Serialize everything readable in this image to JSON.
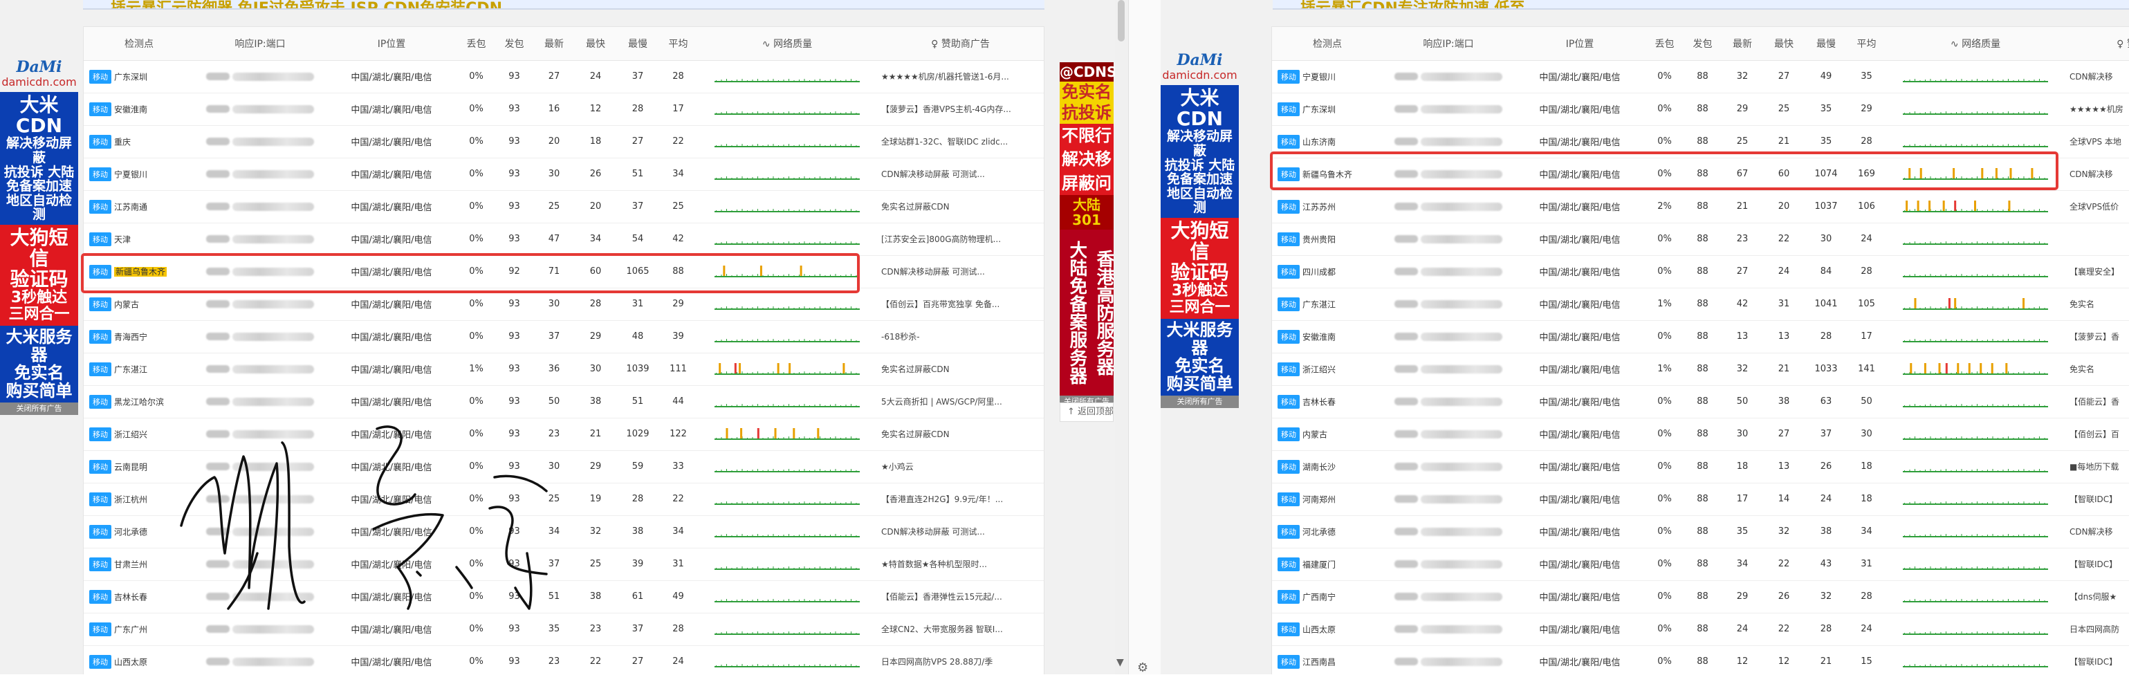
{
  "banner_left": "插云暴汇云防御器 免IE过免受攻击 ISP CDN免安装CDN",
  "banner_right": "插云暴汇CDN专注攻防加速 低至",
  "headers": [
    "检测点",
    "响应IP:端口",
    "IP位置",
    "丢包",
    "发包",
    "最新",
    "最快",
    "最慢",
    "平均",
    "网络质量",
    "赞助商广告"
  ],
  "mobile_badge": "移动",
  "left_rows": [
    {
      "loc": "广东深圳",
      "ip": "中国/湖北/襄阳/电信",
      "loss": "0%",
      "sent": "93",
      "latest": "27",
      "fast": "24",
      "slow": "37",
      "avg": "28",
      "spikes": [],
      "ad": "★★★★★机房/机器托管送1-6月..."
    },
    {
      "loc": "安徽淮南",
      "ip": "中国/湖北/襄阳/电信",
      "loss": "0%",
      "sent": "93",
      "latest": "16",
      "fast": "12",
      "slow": "28",
      "avg": "17",
      "spikes": [],
      "ad": "【菠萝云】香港VPS主机-4G内存..."
    },
    {
      "loc": "重庆",
      "ip": "中国/湖北/襄阳/电信",
      "loss": "0%",
      "sent": "93",
      "latest": "20",
      "fast": "18",
      "slow": "27",
      "avg": "22",
      "spikes": [],
      "ad": "全球站群1-32C、智联IDC zlidc..."
    },
    {
      "loc": "宁夏银川",
      "ip": "中国/湖北/襄阳/电信",
      "loss": "0%",
      "sent": "93",
      "latest": "30",
      "fast": "26",
      "slow": "51",
      "avg": "34",
      "spikes": [],
      "ad": "CDN解决移动屏蔽 可测试..."
    },
    {
      "loc": "江苏南通",
      "ip": "中国/湖北/襄阳/电信",
      "loss": "0%",
      "sent": "93",
      "latest": "25",
      "fast": "20",
      "slow": "37",
      "avg": "25",
      "spikes": [],
      "ad": "免实名过屏蔽CDN"
    },
    {
      "loc": "天津",
      "ip": "中国/湖北/襄阳/电信",
      "loss": "0%",
      "sent": "93",
      "latest": "47",
      "fast": "34",
      "slow": "54",
      "avg": "42",
      "spikes": [],
      "ad": "[江苏安全云]800G高防物理机..."
    },
    {
      "loc": "新疆乌鲁木齐",
      "ip": "中国/湖北/襄阳/电信",
      "loss": "0%",
      "sent": "92",
      "latest": "71",
      "fast": "60",
      "slow": "1065",
      "avg": "88",
      "spikes": [
        {
          "x": 0.06,
          "c": "#e8a000"
        },
        {
          "x": 0.32,
          "c": "#e8a000"
        },
        {
          "x": 0.6,
          "c": "#e8a000"
        }
      ],
      "ad": "CDN解决移动屏蔽 可测试..."
    },
    {
      "loc": "内蒙古",
      "ip": "中国/湖北/襄阳/电信",
      "loss": "0%",
      "sent": "93",
      "latest": "30",
      "fast": "28",
      "slow": "31",
      "avg": "29",
      "spikes": [],
      "ad": "【佰创云】百兆带宽独享 免备..."
    },
    {
      "loc": "青海西宁",
      "ip": "中国/湖北/襄阳/电信",
      "loss": "0%",
      "sent": "93",
      "latest": "37",
      "fast": "29",
      "slow": "48",
      "avg": "39",
      "spikes": [],
      "ad": "-618秒杀-"
    },
    {
      "loc": "广东湛江",
      "ip": "中国/湖北/襄阳/电信",
      "loss": "1%",
      "sent": "93",
      "latest": "36",
      "fast": "30",
      "slow": "1039",
      "avg": "111",
      "spikes": [
        {
          "x": 0.03,
          "c": "#e8a000"
        },
        {
          "x": 0.14,
          "c": "#e53935"
        },
        {
          "x": 0.17,
          "c": "#e8a000"
        },
        {
          "x": 0.44,
          "c": "#e8a000"
        },
        {
          "x": 0.52,
          "c": "#e8a000"
        },
        {
          "x": 0.9,
          "c": "#e8a000"
        }
      ],
      "ad": "免实名过屏蔽CDN"
    },
    {
      "loc": "黑龙江哈尔滨",
      "ip": "中国/湖北/襄阳/电信",
      "loss": "0%",
      "sent": "93",
      "latest": "50",
      "fast": "38",
      "slow": "51",
      "avg": "44",
      "spikes": [],
      "ad": "5大云商折扣 | AWS/GCP/阿里..."
    },
    {
      "loc": "浙江绍兴",
      "ip": "中国/湖北/襄阳/电信",
      "loss": "0%",
      "sent": "93",
      "latest": "23",
      "fast": "21",
      "slow": "1029",
      "avg": "122",
      "spikes": [
        {
          "x": 0.08,
          "c": "#e8a000"
        },
        {
          "x": 0.18,
          "c": "#e8a000"
        },
        {
          "x": 0.3,
          "c": "#e53935"
        },
        {
          "x": 0.42,
          "c": "#e8a000"
        },
        {
          "x": 0.55,
          "c": "#e8a000"
        },
        {
          "x": 0.72,
          "c": "#e8a000"
        }
      ],
      "ad": "免实名过屏蔽CDN"
    },
    {
      "loc": "云南昆明",
      "ip": "中国/湖北/襄阳/电信",
      "loss": "0%",
      "sent": "93",
      "latest": "30",
      "fast": "29",
      "slow": "59",
      "avg": "33",
      "spikes": [],
      "ad": "★小鸡云"
    },
    {
      "loc": "浙江杭州",
      "ip": "中国/湖北/襄阳/电信",
      "loss": "0%",
      "sent": "93",
      "latest": "25",
      "fast": "19",
      "slow": "28",
      "avg": "22",
      "spikes": [],
      "ad": "【香港直连2H2G】9.9元/年！..."
    },
    {
      "loc": "河北承德",
      "ip": "中国/湖北/襄阳/电信",
      "loss": "0%",
      "sent": "93",
      "latest": "34",
      "fast": "32",
      "slow": "38",
      "avg": "34",
      "spikes": [],
      "ad": "CDN解决移动屏蔽 可测试..."
    },
    {
      "loc": "甘肃兰州",
      "ip": "中国/湖北/襄阳/电信",
      "loss": "0%",
      "sent": "93",
      "latest": "37",
      "fast": "25",
      "slow": "39",
      "avg": "31",
      "spikes": [],
      "ad": "★特首数据★各种机型限时..."
    },
    {
      "loc": "吉林长春",
      "ip": "中国/湖北/襄阳/电信",
      "loss": "0%",
      "sent": "93",
      "latest": "51",
      "fast": "38",
      "slow": "61",
      "avg": "49",
      "spikes": [],
      "ad": "【佰能云】香港弹性云15元起/..."
    },
    {
      "loc": "广东广州",
      "ip": "中国/湖北/襄阳/电信",
      "loss": "0%",
      "sent": "93",
      "latest": "35",
      "fast": "23",
      "slow": "37",
      "avg": "28",
      "spikes": [],
      "ad": "全球CN2、大带宽服务器 智联I..."
    },
    {
      "loc": "山西太原",
      "ip": "中国/湖北/襄阳/电信",
      "loss": "0%",
      "sent": "93",
      "latest": "23",
      "fast": "22",
      "slow": "27",
      "avg": "24",
      "spikes": [],
      "ad": "日本四网高防VPS 28.88刀/季"
    }
  ],
  "right_rows": [
    {
      "loc": "宁夏银川",
      "ip": "中国/湖北/襄阳/电信",
      "loss": "0%",
      "sent": "88",
      "latest": "32",
      "fast": "27",
      "slow": "49",
      "avg": "35",
      "spikes": [],
      "ad": "CDN解决移"
    },
    {
      "loc": "广东深圳",
      "ip": "中国/湖北/襄阳/电信",
      "loss": "0%",
      "sent": "88",
      "latest": "29",
      "fast": "25",
      "slow": "35",
      "avg": "29",
      "spikes": [],
      "ad": "★★★★★机房"
    },
    {
      "loc": "山东济南",
      "ip": "中国/湖北/襄阳/电信",
      "loss": "0%",
      "sent": "88",
      "latest": "25",
      "fast": "21",
      "slow": "35",
      "avg": "28",
      "spikes": [],
      "ad": "全球VPS 本地"
    },
    {
      "loc": "新疆乌鲁木齐",
      "ip": "中国/湖北/襄阳/电信",
      "loss": "0%",
      "sent": "88",
      "latest": "67",
      "fast": "60",
      "slow": "1074",
      "avg": "169",
      "spikes": [
        {
          "x": 0.04,
          "c": "#e8a000"
        },
        {
          "x": 0.12,
          "c": "#e8a000"
        },
        {
          "x": 0.35,
          "c": "#e8a000"
        },
        {
          "x": 0.55,
          "c": "#e8a000"
        },
        {
          "x": 0.65,
          "c": "#e8a000"
        },
        {
          "x": 0.75,
          "c": "#e8a000"
        },
        {
          "x": 0.9,
          "c": "#e8a000"
        }
      ],
      "ad": "CDN解决移"
    },
    {
      "loc": "江苏苏州",
      "ip": "中国/湖北/襄阳/电信",
      "loss": "2%",
      "sent": "88",
      "latest": "21",
      "fast": "20",
      "slow": "1037",
      "avg": "106",
      "spikes": [
        {
          "x": 0.02,
          "c": "#e8a000"
        },
        {
          "x": 0.1,
          "c": "#e8a000"
        },
        {
          "x": 0.18,
          "c": "#e8a000"
        },
        {
          "x": 0.28,
          "c": "#e8a000"
        },
        {
          "x": 0.36,
          "c": "#e53935"
        },
        {
          "x": 0.5,
          "c": "#e8a000"
        },
        {
          "x": 0.74,
          "c": "#e8a000"
        }
      ],
      "ad": "全球VPS低价"
    },
    {
      "loc": "贵州贵阳",
      "ip": "中国/湖北/襄阳/电信",
      "loss": "0%",
      "sent": "88",
      "latest": "23",
      "fast": "22",
      "slow": "30",
      "avg": "24",
      "spikes": [],
      "ad": ""
    },
    {
      "loc": "四川成都",
      "ip": "中国/湖北/襄阳/电信",
      "loss": "0%",
      "sent": "88",
      "latest": "27",
      "fast": "24",
      "slow": "84",
      "avg": "28",
      "spikes": [],
      "ad": "【襄理安全】"
    },
    {
      "loc": "广东湛江",
      "ip": "中国/湖北/襄阳/电信",
      "loss": "1%",
      "sent": "88",
      "latest": "42",
      "fast": "31",
      "slow": "1041",
      "avg": "105",
      "spikes": [
        {
          "x": 0.08,
          "c": "#e8a000"
        },
        {
          "x": 0.32,
          "c": "#e53935"
        },
        {
          "x": 0.36,
          "c": "#e8a000"
        },
        {
          "x": 0.84,
          "c": "#e8a000"
        }
      ],
      "ad": "免实名"
    },
    {
      "loc": "安徽淮南",
      "ip": "中国/湖北/襄阳/电信",
      "loss": "0%",
      "sent": "88",
      "latest": "13",
      "fast": "13",
      "slow": "28",
      "avg": "17",
      "spikes": [],
      "ad": "【菠萝云】香"
    },
    {
      "loc": "浙江绍兴",
      "ip": "中国/湖北/襄阳/电信",
      "loss": "1%",
      "sent": "88",
      "latest": "32",
      "fast": "21",
      "slow": "1033",
      "avg": "141",
      "spikes": [
        {
          "x": 0.05,
          "c": "#e8a000"
        },
        {
          "x": 0.15,
          "c": "#e8a000"
        },
        {
          "x": 0.25,
          "c": "#e8a000"
        },
        {
          "x": 0.3,
          "c": "#e53935"
        },
        {
          "x": 0.38,
          "c": "#e8a000"
        },
        {
          "x": 0.46,
          "c": "#e8a000"
        },
        {
          "x": 0.54,
          "c": "#e8a000"
        },
        {
          "x": 0.62,
          "c": "#e8a000"
        },
        {
          "x": 0.72,
          "c": "#e8a000"
        }
      ],
      "ad": "免实名"
    },
    {
      "loc": "吉林长春",
      "ip": "中国/湖北/襄阳/电信",
      "loss": "0%",
      "sent": "88",
      "latest": "50",
      "fast": "38",
      "slow": "63",
      "avg": "50",
      "spikes": [],
      "ad": "【佰能云】香"
    },
    {
      "loc": "内蒙古",
      "ip": "中国/湖北/襄阳/电信",
      "loss": "0%",
      "sent": "88",
      "latest": "30",
      "fast": "27",
      "slow": "37",
      "avg": "30",
      "spikes": [],
      "ad": "【佰创云】百"
    },
    {
      "loc": "湖南长沙",
      "ip": "中国/湖北/襄阳/电信",
      "loss": "0%",
      "sent": "88",
      "latest": "18",
      "fast": "13",
      "slow": "26",
      "avg": "18",
      "spikes": [],
      "ad": "■每地历下载"
    },
    {
      "loc": "河南郑州",
      "ip": "中国/湖北/襄阳/电信",
      "loss": "0%",
      "sent": "88",
      "latest": "17",
      "fast": "14",
      "slow": "24",
      "avg": "18",
      "spikes": [],
      "ad": "【智联IDC】"
    },
    {
      "loc": "河北承德",
      "ip": "中国/湖北/襄阳/电信",
      "loss": "0%",
      "sent": "88",
      "latest": "35",
      "fast": "32",
      "slow": "38",
      "avg": "34",
      "spikes": [],
      "ad": "CDN解决移"
    },
    {
      "loc": "福建厦门",
      "ip": "中国/湖北/襄阳/电信",
      "loss": "0%",
      "sent": "88",
      "latest": "34",
      "fast": "22",
      "slow": "43",
      "avg": "31",
      "spikes": [],
      "ad": "【智联IDC】"
    },
    {
      "loc": "广西南宁",
      "ip": "中国/湖北/襄阳/电信",
      "loss": "0%",
      "sent": "88",
      "latest": "29",
      "fast": "26",
      "slow": "32",
      "avg": "28",
      "spikes": [],
      "ad": "【dns伺服★"
    },
    {
      "loc": "山西太原",
      "ip": "中国/湖北/襄阳/电信",
      "loss": "0%",
      "sent": "88",
      "latest": "24",
      "fast": "22",
      "slow": "28",
      "avg": "24",
      "spikes": [],
      "ad": "日本四网高防"
    },
    {
      "loc": "江西南昌",
      "ip": "中国/湖北/襄阳/电信",
      "loss": "0%",
      "sent": "88",
      "latest": "12",
      "fast": "12",
      "slow": "21",
      "avg": "15",
      "spikes": [],
      "ad": "【智联IDC】"
    }
  ],
  "left_sidead": {
    "logo": "DaMi",
    "url": "damicdn.com",
    "l1": "大米CDN",
    "l2": "解决移动屏蔽",
    "l3": "抗投诉 大陆",
    "l4": "免备案加速",
    "l5": "地区自动检测",
    "l6": "大狗短信",
    "l7": "验证码",
    "l8": "3秒触达",
    "l9": "三网合一",
    "l10": "大米服务器",
    "l11": "免实名",
    "l12": "购买简单",
    "close": "关闭所有广告"
  },
  "right_sidead": {
    "logo": "DaMi",
    "url": "damicdn.com",
    "l1": "大米CDN",
    "l2": "解决移动屏蔽",
    "l3": "抗投诉 大陆",
    "l4": "免备案加速",
    "l5": "地区自动检测",
    "l6": "大狗短信",
    "l7": "验证码",
    "l8": "3秒触达",
    "l9": "三网合一",
    "l10": "大米服务器",
    "l11": "免实名",
    "l12": "购买简单",
    "close": "关闭所有广告"
  },
  "left_rad": {
    "top": "@CDNS",
    "yel1": "免实名",
    "yel2": "抗投诉",
    "r1": "不限行",
    "r2": "解决移",
    "r3": "屏蔽问",
    "dk": "大陆301",
    "c1": "大陆免备案服务器",
    "c2": "香港高防服务器",
    "close": "关闭所有广告"
  },
  "back_top": "返回顶部",
  "handwriting": "tracing-scribble"
}
